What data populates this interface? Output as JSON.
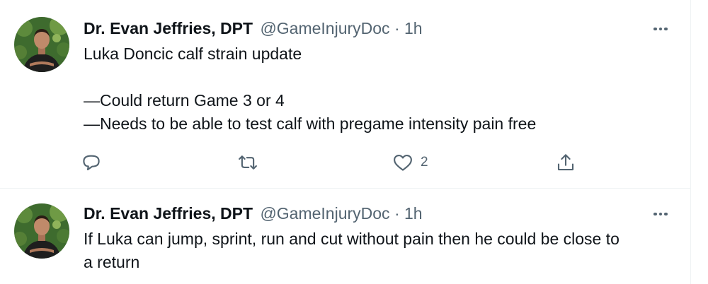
{
  "tweets": [
    {
      "author_name": "Dr. Evan Jeffries, DPT",
      "handle": "@GameInjuryDoc",
      "separator": "·",
      "time": "1h",
      "lines": [
        "Luka Doncic calf strain update",
        "",
        "—Could return Game 3 or 4",
        "—Needs to be able to test calf with pregame intensity pain free"
      ],
      "actions": {
        "reply_icon": "reply-icon",
        "retweet_icon": "retweet-icon",
        "like_icon": "like-icon",
        "like_count": "2",
        "share_icon": "share-icon"
      }
    },
    {
      "author_name": "Dr. Evan Jeffries, DPT",
      "handle": "@GameInjuryDoc",
      "separator": "·",
      "time": "1h",
      "lines": [
        "If Luka can jump, sprint, run and cut without pain then he could be close to",
        "a return"
      ]
    }
  ],
  "colors": {
    "text_primary": "#0f1419",
    "text_secondary": "#536471",
    "divider": "#eff3f4"
  }
}
